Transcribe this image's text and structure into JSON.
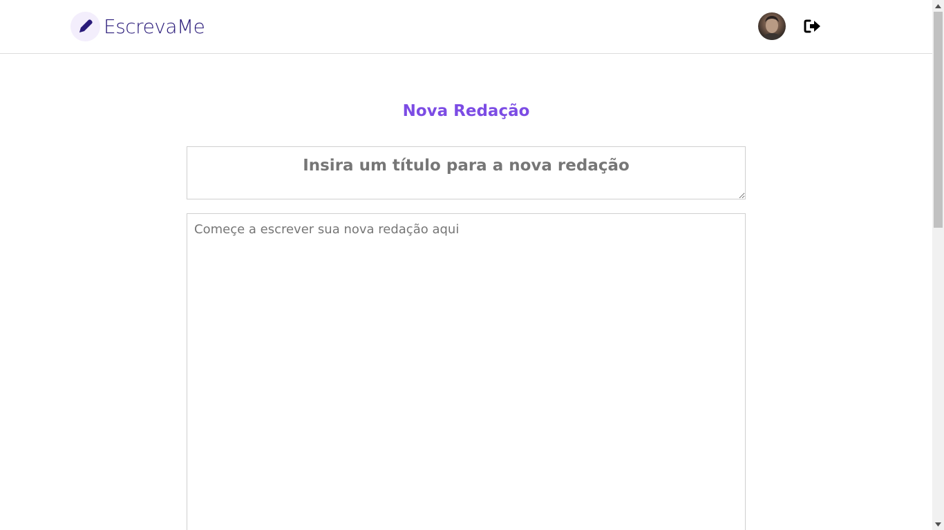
{
  "header": {
    "brand": "EscrevaMe",
    "logo_icon": "pencil-icon",
    "avatar_icon": "user-avatar",
    "logout_icon": "sign-out-icon",
    "brand_color": "#2a1b7a",
    "badge_color": "#f3eefc"
  },
  "main": {
    "heading": "Nova Redação",
    "heading_color": "#7c4ce4",
    "title_field": {
      "placeholder": "Insira um título para a nova redação",
      "value": ""
    },
    "body_field": {
      "placeholder": "Começe a escrever sua nova redação aqui",
      "value": ""
    }
  },
  "scrollbar": {
    "up_icon": "scroll-up-arrow-icon",
    "down_icon": "scroll-down-arrow-icon"
  }
}
